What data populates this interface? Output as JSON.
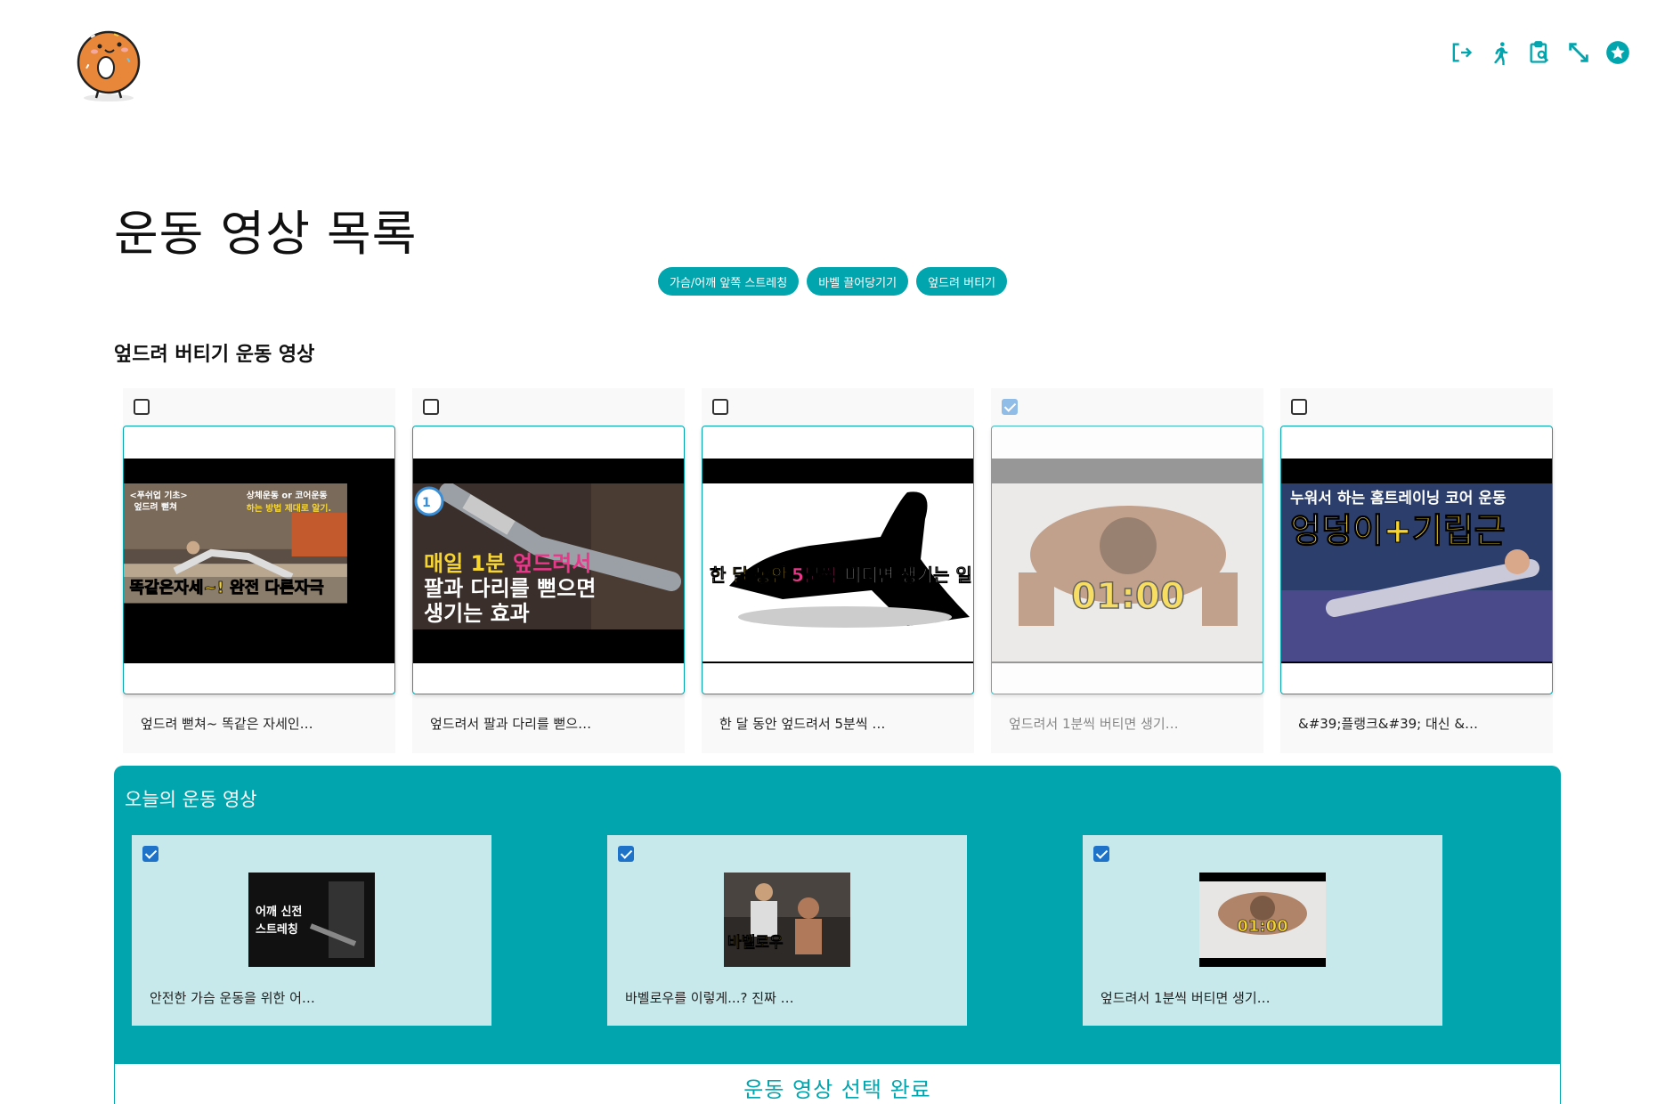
{
  "header": {
    "logo_icon": "bagel-character-logo",
    "icons": [
      "logout-icon",
      "running-icon",
      "clipboard-search-icon",
      "expand-arrows-icon",
      "star-badge-icon"
    ],
    "accent_color": "#00a5ae"
  },
  "page_title": "운동 영상 목록",
  "chips": [
    "가슴/어깨 앞쪽 스트레칭",
    "바벨 끌어당기기",
    "엎드려 버티기"
  ],
  "section_title": "엎드려 버티기 운동 영상",
  "videos": [
    {
      "checked": false,
      "caption": "엎드려 뻗쳐~ 똑같은 자세인…",
      "thumb_text": [
        "<푸쉬업 기초>",
        "엎드려 뻗쳐",
        "상체운동 or 코어운동",
        "하는 방법 제대로 알기.",
        "똑같은자세~! 완전 다른자극"
      ]
    },
    {
      "checked": false,
      "caption": "엎드려서 팔과 다리를 뻗으…",
      "thumb_text": [
        "매일 1분",
        "엎드려서",
        "팔과 다리를 뻗으면",
        "생기는 효과"
      ]
    },
    {
      "checked": false,
      "caption": "한 달 동안 엎드려서 5분씩 …",
      "thumb_text": [
        "한 달 동안",
        "5분씩",
        "버티면 생기는 일"
      ]
    },
    {
      "checked": true,
      "caption": "엎드려서 1분씩 버티면 생기…",
      "thumb_text": [
        "01:00"
      ]
    },
    {
      "checked": false,
      "caption": "&#39;플랭크&#39; 대신 &…",
      "thumb_text": [
        "누워서 하는 홈트레이닝 코어 운동",
        "엉덩이+기립근"
      ]
    }
  ],
  "today": {
    "title": "오늘의 운동 영상",
    "items": [
      {
        "checked": true,
        "caption": "안전한 가슴 운동을 위한 어…",
        "thumb_text": [
          "어깨 신전",
          "스트레칭"
        ]
      },
      {
        "checked": true,
        "caption": "바벨로우를 이렇게...? 진짜 …",
        "thumb_text": [
          "바벨로우"
        ]
      },
      {
        "checked": true,
        "caption": "엎드려서 1분씩 버티면 생기…",
        "thumb_text": [
          "01:00"
        ]
      }
    ]
  },
  "complete_button": "운동 영상 선택 완료"
}
